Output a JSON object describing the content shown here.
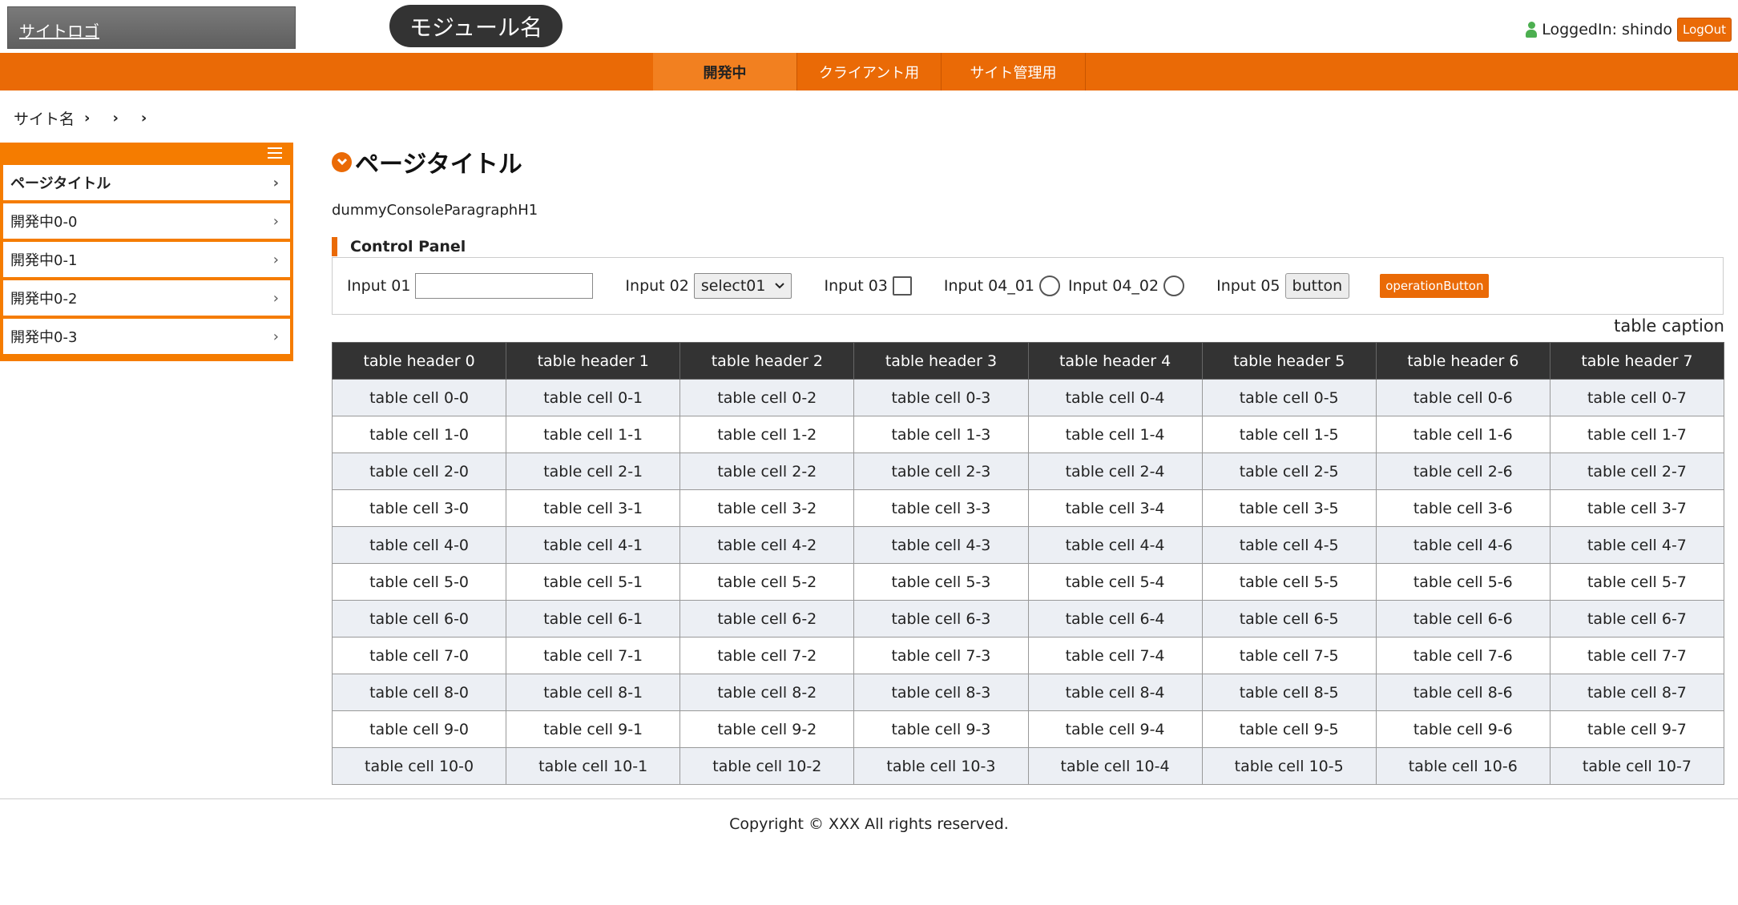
{
  "header": {
    "site_logo": "サイトロゴ",
    "module_name": "モジュール名",
    "logged_in": "LoggedIn: shindo",
    "logout": "LogOut"
  },
  "nav": {
    "items": [
      {
        "label": "開発中",
        "active": true
      },
      {
        "label": "クライアント用",
        "active": false
      },
      {
        "label": "サイト管理用",
        "active": false
      }
    ]
  },
  "breadcrumb": {
    "site_name": "サイト名",
    "separator": "›"
  },
  "sidebar": {
    "items": [
      {
        "label": "ページタイトル"
      },
      {
        "label": "開発中0-0"
      },
      {
        "label": "開発中0-1"
      },
      {
        "label": "開発中0-2"
      },
      {
        "label": "開発中0-3"
      }
    ],
    "chevron": "›"
  },
  "main": {
    "page_title": "ページタイトル",
    "paragraph": "dummyConsoleParagraphH1",
    "panel_title": "Control Panel",
    "controls": {
      "input01_label": "Input 01",
      "input02_label": "Input 02",
      "select_value": "select01",
      "input03_label": "Input 03",
      "input04_01_label": "Input 04_01",
      "input04_02_label": "Input 04_02",
      "input05_label": "Input 05",
      "button_label": "button",
      "operation_button": "operationButton"
    },
    "table": {
      "caption": "table caption",
      "headers": [
        "table header 0",
        "table header 1",
        "table header 2",
        "table header 3",
        "table header 4",
        "table header 5",
        "table header 6",
        "table header 7"
      ],
      "rows": [
        [
          "table cell 0-0",
          "table cell 0-1",
          "table cell 0-2",
          "table cell 0-3",
          "table cell 0-4",
          "table cell 0-5",
          "table cell 0-6",
          "table cell 0-7"
        ],
        [
          "table cell 1-0",
          "table cell 1-1",
          "table cell 1-2",
          "table cell 1-3",
          "table cell 1-4",
          "table cell 1-5",
          "table cell 1-6",
          "table cell 1-7"
        ],
        [
          "table cell 2-0",
          "table cell 2-1",
          "table cell 2-2",
          "table cell 2-3",
          "table cell 2-4",
          "table cell 2-5",
          "table cell 2-6",
          "table cell 2-7"
        ],
        [
          "table cell 3-0",
          "table cell 3-1",
          "table cell 3-2",
          "table cell 3-3",
          "table cell 3-4",
          "table cell 3-5",
          "table cell 3-6",
          "table cell 3-7"
        ],
        [
          "table cell 4-0",
          "table cell 4-1",
          "table cell 4-2",
          "table cell 4-3",
          "table cell 4-4",
          "table cell 4-5",
          "table cell 4-6",
          "table cell 4-7"
        ],
        [
          "table cell 5-0",
          "table cell 5-1",
          "table cell 5-2",
          "table cell 5-3",
          "table cell 5-4",
          "table cell 5-5",
          "table cell 5-6",
          "table cell 5-7"
        ],
        [
          "table cell 6-0",
          "table cell 6-1",
          "table cell 6-2",
          "table cell 6-3",
          "table cell 6-4",
          "table cell 6-5",
          "table cell 6-6",
          "table cell 6-7"
        ],
        [
          "table cell 7-0",
          "table cell 7-1",
          "table cell 7-2",
          "table cell 7-3",
          "table cell 7-4",
          "table cell 7-5",
          "table cell 7-6",
          "table cell 7-7"
        ],
        [
          "table cell 8-0",
          "table cell 8-1",
          "table cell 8-2",
          "table cell 8-3",
          "table cell 8-4",
          "table cell 8-5",
          "table cell 8-6",
          "table cell 8-7"
        ],
        [
          "table cell 9-0",
          "table cell 9-1",
          "table cell 9-2",
          "table cell 9-3",
          "table cell 9-4",
          "table cell 9-5",
          "table cell 9-6",
          "table cell 9-7"
        ],
        [
          "table cell 10-0",
          "table cell 10-1",
          "table cell 10-2",
          "table cell 10-3",
          "table cell 10-4",
          "table cell 10-5",
          "table cell 10-6",
          "table cell 10-7"
        ]
      ]
    }
  },
  "footer": {
    "copyright": "Copyright © XXX All rights reserved."
  },
  "colors": {
    "accent": "#ea6a06",
    "header_dark": "#333333",
    "row_stripe": "#eceff4"
  }
}
